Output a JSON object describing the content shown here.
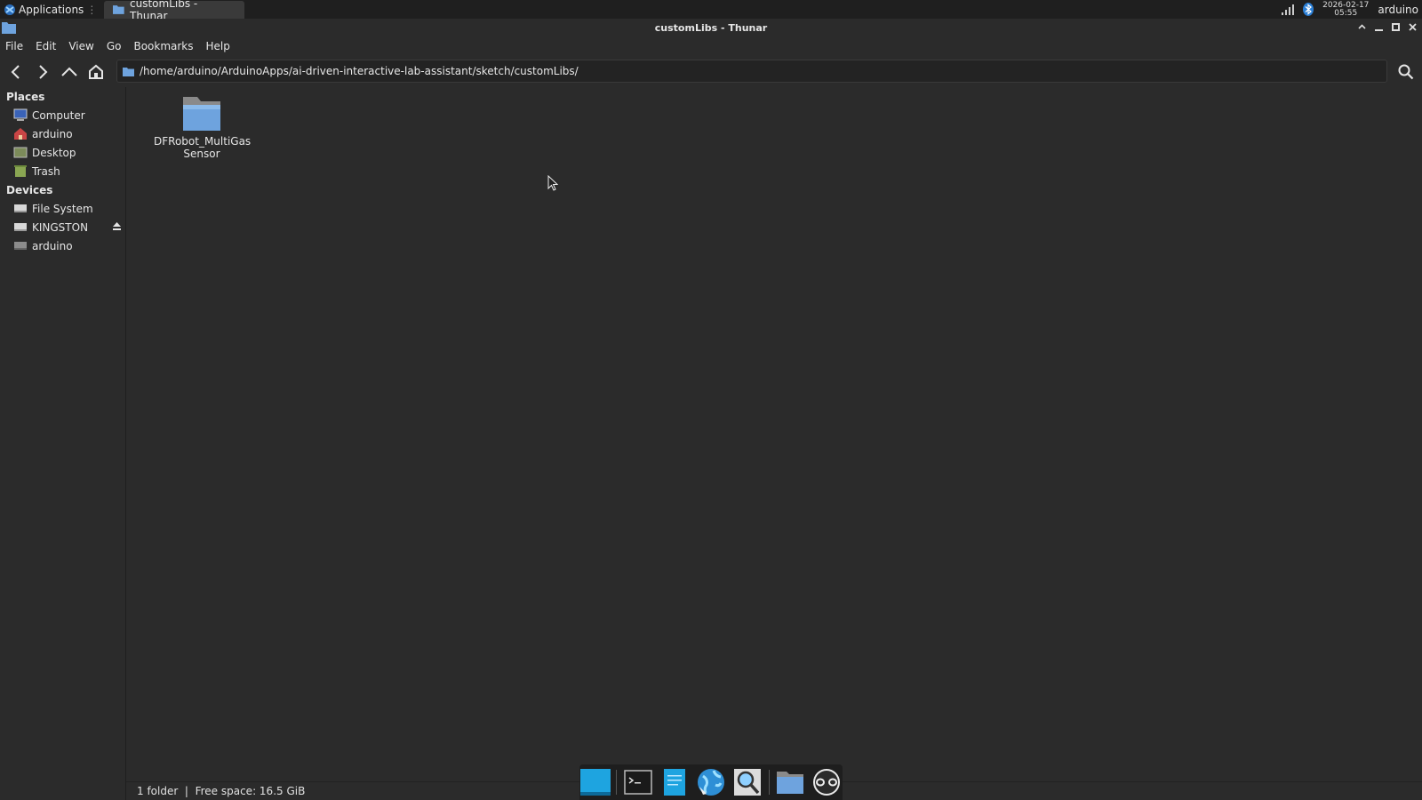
{
  "panel": {
    "applications_label": "Applications",
    "task_label": "customLibs - Thunar",
    "clock_date": "2026-02-17",
    "clock_time": "05:55",
    "user": "arduino"
  },
  "window": {
    "title": "customLibs - Thunar"
  },
  "menubar": {
    "items": [
      "File",
      "Edit",
      "View",
      "Go",
      "Bookmarks",
      "Help"
    ]
  },
  "toolbar": {
    "path": "/home/arduino/ArduinoApps/ai-driven-interactive-lab-assistant/sketch/customLibs/"
  },
  "sidebar": {
    "places_header": "Places",
    "places": [
      {
        "label": "Computer",
        "icon": "computer-icon"
      },
      {
        "label": "arduino",
        "icon": "home-icon"
      },
      {
        "label": "Desktop",
        "icon": "desktop-icon"
      },
      {
        "label": "Trash",
        "icon": "trash-icon"
      }
    ],
    "devices_header": "Devices",
    "devices": [
      {
        "label": "File System",
        "icon": "drive-icon"
      },
      {
        "label": "KINGSTON",
        "icon": "drive-icon"
      },
      {
        "label": "arduino",
        "icon": "drive-icon"
      }
    ]
  },
  "files": [
    {
      "name": "DFRobot_MultiGas Sensor",
      "type": "folder"
    }
  ],
  "status": {
    "text": "1 folder  |  Free space: 16.5 GiB"
  },
  "dock": {
    "items": [
      "show-desktop-icon",
      "terminal-icon",
      "text-editor-icon",
      "web-browser-icon",
      "app-finder-icon",
      "file-manager-icon",
      "arduino-icon"
    ]
  },
  "colors": {
    "background": "#2b2b2b",
    "panel": "#1f1f1f",
    "folder_blue": "#6ea3de",
    "accent_cyan": "#1ea4e0"
  }
}
